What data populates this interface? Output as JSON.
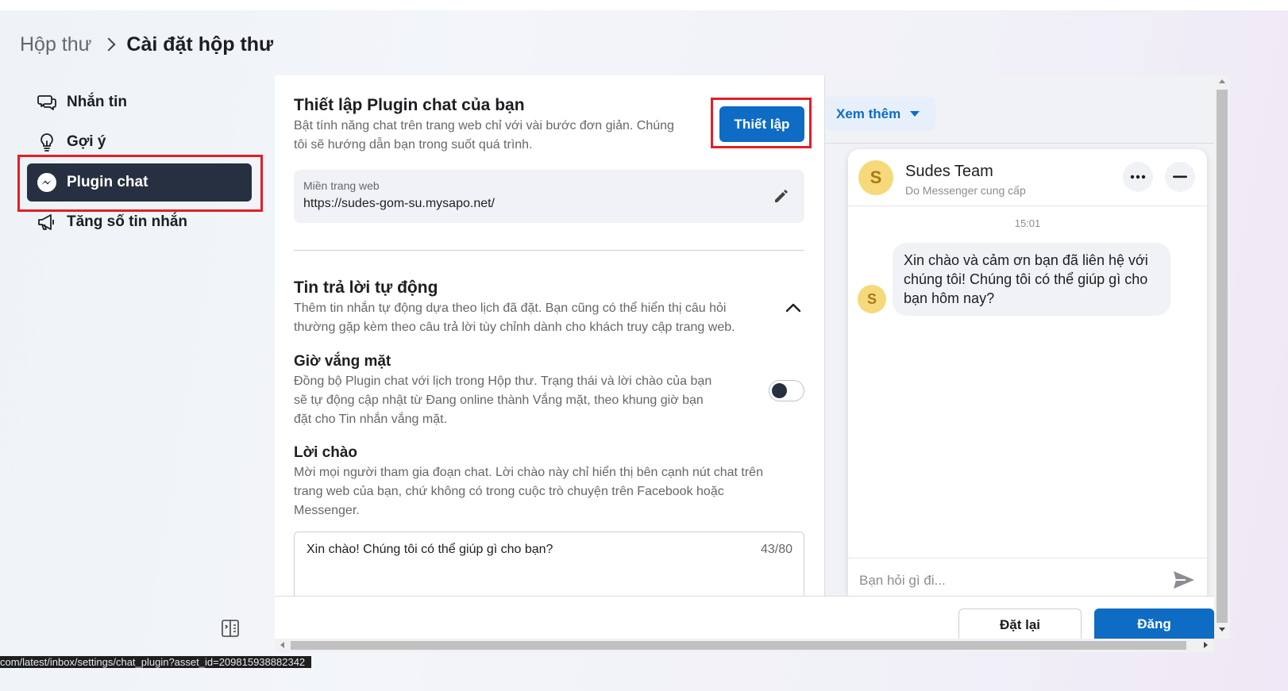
{
  "breadcrumb": {
    "parent": "Hộp thư",
    "current": "Cài đặt hộp thư"
  },
  "sidebar": {
    "items": [
      {
        "label": "Nhắn tin",
        "icon": "chat-bubbles-icon"
      },
      {
        "label": "Gợi ý",
        "icon": "lightbulb-icon"
      },
      {
        "label": "Plugin chat",
        "icon": "messenger-icon",
        "active": true
      },
      {
        "label": "Tăng số tin nhắn",
        "icon": "megaphone-icon"
      }
    ]
  },
  "setup": {
    "title": "Thiết lập Plugin chat của bạn",
    "desc_line1": "Bật tính năng chat trên trang web chỉ với vài bước đơn giản. Chúng",
    "desc_line2": "tôi sẽ hướng dẫn bạn trong suốt quá trình.",
    "button": "Thiết lập",
    "domain_label": "Miền trang web",
    "domain_value": "https://sudes-gom-su.mysapo.net/"
  },
  "auto_reply": {
    "title": "Tin trả lời tự động",
    "desc_line1": "Thêm tin nhắn tự động dựa theo lịch đã đặt. Bạn cũng có thể hiển thị câu hỏi",
    "desc_line2": "thường gặp kèm theo câu trả lời tùy chỉnh dành cho khách truy cập trang web."
  },
  "away": {
    "title": "Giờ vắng mặt",
    "desc_line1": "Đồng bộ Plugin chat với lịch trong Hộp thư. Trạng thái và lời chào của bạn",
    "desc_line2": "sẽ tự động cập nhật từ Đang online thành Vắng mặt, theo khung giờ bạn",
    "desc_line3": "đặt cho Tin nhắn vắng mặt.",
    "toggle_on": false
  },
  "greeting": {
    "title": "Lời chào",
    "desc_line1": "Mời mọi người tham gia đoạn chat. Lời chào này chỉ hiển thị bên cạnh nút chat trên",
    "desc_line2": "trang web của bạn, chứ không có trong cuộc trò chuyện trên Facebook hoặc",
    "desc_line3": "Messenger.",
    "value": "Xin chào! Chúng tôi có thể giúp gì cho bạn?",
    "count": "43/80"
  },
  "preview": {
    "more_button": "Xem thêm",
    "avatar_letter": "S",
    "name": "Sudes Team",
    "subtitle": "Do Messenger cung cấp",
    "time": "15:01",
    "message": "Xin chào và cảm ơn bạn đã liên hệ với chúng tôi! Chúng tôi có thể giúp gì cho bạn hôm nay?",
    "input_placeholder": "Bạn hỏi gì đi..."
  },
  "actions": {
    "reset": "Đặt lại",
    "post": "Đăng"
  },
  "status_url": "com/latest/inbox/settings/chat_plugin?asset_id=209815938882342",
  "colors": {
    "primary": "#0e6cc4",
    "active_nav": "#263040",
    "highlight": "#e41e26",
    "avatar": "#f6d97a"
  }
}
